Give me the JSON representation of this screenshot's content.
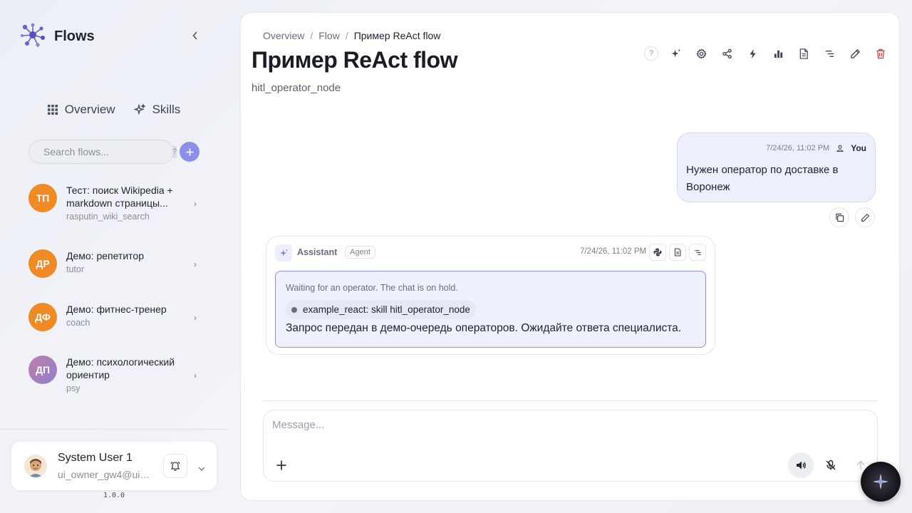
{
  "app": {
    "name": "Flows",
    "version": "1.0.0"
  },
  "nav": {
    "overview": "Overview",
    "skills": "Skills"
  },
  "search": {
    "placeholder": "Search flows...",
    "help": "?"
  },
  "flows": [
    {
      "initials": "ТП",
      "title": "Тест: поиск Wikipedia + markdown страницы...",
      "slug": "rasputin_wiki_search",
      "color": "#f08a24"
    },
    {
      "initials": "ДР",
      "title": "Демо: репетитор",
      "slug": "tutor",
      "color": "#f08a24"
    },
    {
      "initials": "ДФ",
      "title": "Демо: фитнес-тренер",
      "slug": "coach",
      "color": "#f08a24"
    },
    {
      "initials": "ДП",
      "title": "Демо: психологический ориентир",
      "slug": "psy",
      "color": "#9a7fc2"
    }
  ],
  "user": {
    "name": "System User 1",
    "email": "ui_owner_gw4@ui_..."
  },
  "breadcrumb": {
    "overview": "Overview",
    "flow": "Flow",
    "current": "Пример ReAct flow"
  },
  "page": {
    "title": "Пример ReAct flow",
    "subtitle": "hitl_operator_node"
  },
  "toolbar": {
    "help": "?"
  },
  "chat": {
    "user_message": {
      "time": "7/24/26, 11:02 PM",
      "author": "You",
      "text": "Нужен оператор по доставке в Воронеж"
    },
    "assistant_message": {
      "author": "Assistant",
      "badge": "Agent",
      "time": "7/24/26, 11:02 PM",
      "status": "Waiting for an operator. The chat is on hold.",
      "skill": "example_react: skill hitl_operator_node",
      "text": "Запрос передан в демо-очередь операторов. Ожидайте ответа специалиста."
    }
  },
  "composer": {
    "placeholder": "Message..."
  },
  "colors": {
    "accent": "#8c8fe8",
    "danger": "#e53935",
    "hold_border": "#8f93e6"
  }
}
